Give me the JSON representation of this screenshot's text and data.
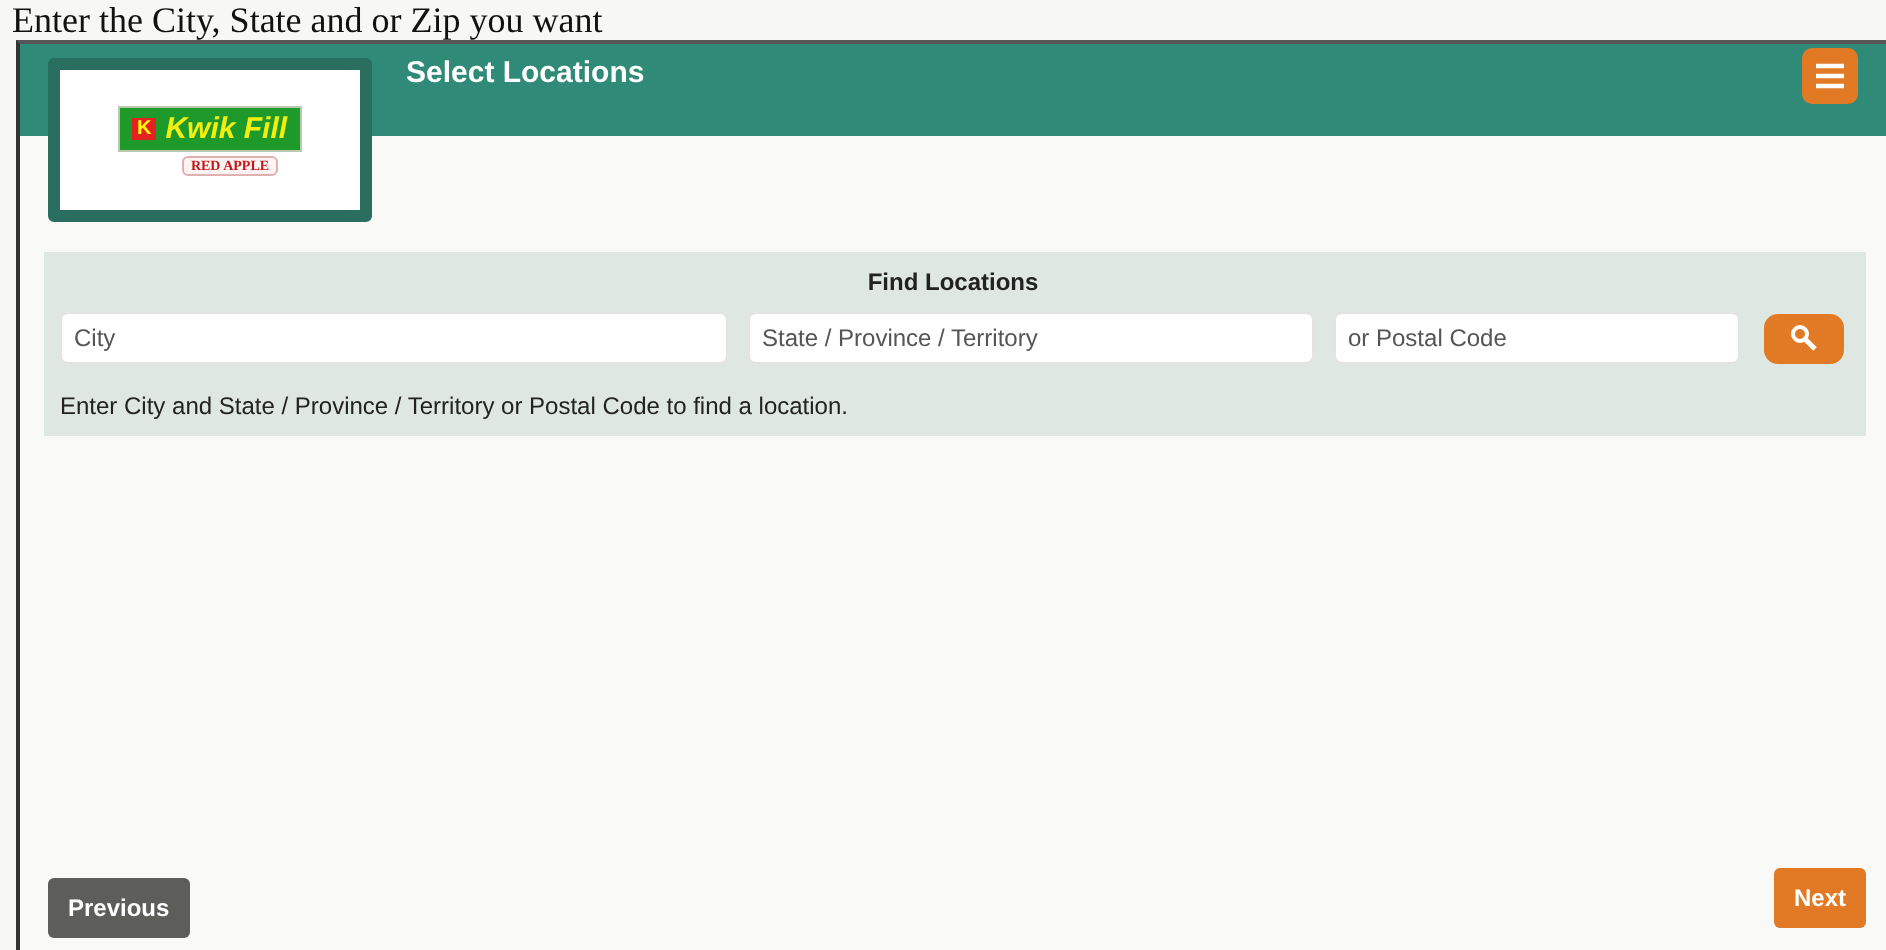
{
  "caption": "Enter the City, State and or Zip you want",
  "header": {
    "logo": {
      "mark": "K",
      "name": "Kwik Fill",
      "sub": "RED APPLE"
    },
    "title": "Select Locations"
  },
  "finder": {
    "title": "Find Locations",
    "fields": [
      {
        "placeholder": "City"
      },
      {
        "placeholder": "State / Province / Territory"
      },
      {
        "placeholder": "or Postal Code"
      }
    ],
    "hint": "Enter City and State / Province / Territory or Postal Code to find a location."
  },
  "buttons": [
    {
      "label": "Previous",
      "kind": "secondary"
    },
    {
      "label": "Next",
      "kind": "primary"
    }
  ]
}
